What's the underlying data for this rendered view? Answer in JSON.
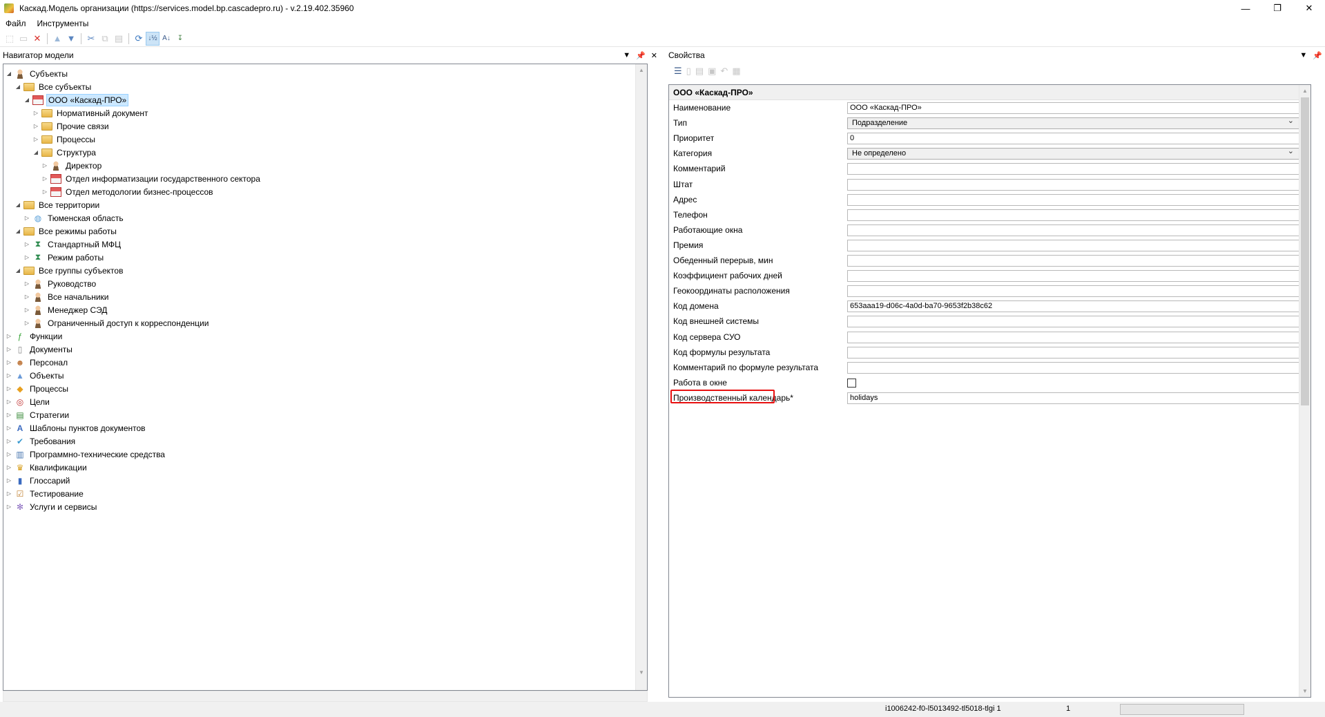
{
  "window": {
    "title": "Каскад.Модель организации (https://services.model.bp.cascadepro.ru) - v.2.19.402.35960",
    "minimize": "—",
    "restore": "❐",
    "close": "✕"
  },
  "menu": [
    "Файл",
    "Инструменты"
  ],
  "toolbar": {
    "icons": [
      "new-icon",
      "open-icon",
      "delete-icon",
      "move-up-icon",
      "move-down-icon",
      "cut-icon",
      "copy-icon",
      "paste-icon",
      "refresh-icon",
      "sort-asc-icon",
      "sort-desc-icon",
      "sort-icon"
    ]
  },
  "navigator": {
    "title": "Навигатор модели",
    "tree": [
      {
        "label": "Субъекты",
        "level": 0,
        "expanded": true,
        "icon": "subjects-icon"
      },
      {
        "label": "Все субъекты",
        "level": 1,
        "expanded": true,
        "icon": "folder-icon"
      },
      {
        "label": "ООО «Каскад-ПРО»",
        "level": 2,
        "expanded": true,
        "icon": "org-icon",
        "selected": true
      },
      {
        "label": "Нормативный документ",
        "level": 3,
        "expanded": false,
        "icon": "folder-icon"
      },
      {
        "label": "Прочие связи",
        "level": 3,
        "expanded": false,
        "icon": "folder-icon"
      },
      {
        "label": "Процессы",
        "level": 3,
        "expanded": false,
        "icon": "folder-icon"
      },
      {
        "label": "Структура",
        "level": 3,
        "expanded": true,
        "icon": "folder-icon"
      },
      {
        "label": "Директор",
        "level": 4,
        "expanded": false,
        "icon": "person-icon"
      },
      {
        "label": "Отдел информатизации государственного сектора",
        "level": 4,
        "expanded": false,
        "icon": "org-icon"
      },
      {
        "label": "Отдел методологии бизнес-процессов",
        "level": 4,
        "expanded": false,
        "icon": "org-icon"
      },
      {
        "label": "Все территории",
        "level": 1,
        "expanded": true,
        "icon": "folder-icon"
      },
      {
        "label": "Тюменская область",
        "level": 2,
        "expanded": false,
        "icon": "globe-icon"
      },
      {
        "label": "Все режимы работы",
        "level": 1,
        "expanded": true,
        "icon": "folder-icon"
      },
      {
        "label": "Стандартный МФЦ",
        "level": 2,
        "expanded": false,
        "icon": "schedule-icon"
      },
      {
        "label": "Режим работы",
        "level": 2,
        "expanded": false,
        "icon": "schedule-icon"
      },
      {
        "label": "Все группы субъектов",
        "level": 1,
        "expanded": true,
        "icon": "folder-icon"
      },
      {
        "label": "Руководство",
        "level": 2,
        "expanded": false,
        "icon": "group-icon"
      },
      {
        "label": "Все начальники",
        "level": 2,
        "expanded": false,
        "icon": "group-icon"
      },
      {
        "label": "Менеджер СЭД",
        "level": 2,
        "expanded": false,
        "icon": "group-icon"
      },
      {
        "label": "Ограниченный доступ к корреспонденции",
        "level": 2,
        "expanded": false,
        "icon": "group-icon"
      },
      {
        "label": "Функции",
        "level": 0,
        "expanded": false,
        "icon": "function-icon"
      },
      {
        "label": "Документы",
        "level": 0,
        "expanded": false,
        "icon": "document-icon"
      },
      {
        "label": "Персонал",
        "level": 0,
        "expanded": false,
        "icon": "personnel-icon"
      },
      {
        "label": "Объекты",
        "level": 0,
        "expanded": false,
        "icon": "objects-icon"
      },
      {
        "label": "Процессы",
        "level": 0,
        "expanded": false,
        "icon": "process-icon"
      },
      {
        "label": "Цели",
        "level": 0,
        "expanded": false,
        "icon": "goals-icon"
      },
      {
        "label": "Стратегии",
        "level": 0,
        "expanded": false,
        "icon": "strategy-icon"
      },
      {
        "label": "Шаблоны пунктов документов",
        "level": 0,
        "expanded": false,
        "icon": "template-icon"
      },
      {
        "label": "Требования",
        "level": 0,
        "expanded": false,
        "icon": "requirements-icon"
      },
      {
        "label": "Программно-технические средства",
        "level": 0,
        "expanded": false,
        "icon": "software-icon"
      },
      {
        "label": "Квалификации",
        "level": 0,
        "expanded": false,
        "icon": "qualification-icon"
      },
      {
        "label": "Глоссарий",
        "level": 0,
        "expanded": false,
        "icon": "glossary-icon"
      },
      {
        "label": "Тестирование",
        "level": 0,
        "expanded": false,
        "icon": "testing-icon"
      },
      {
        "label": "Услуги и сервисы",
        "level": 0,
        "expanded": false,
        "icon": "services-icon"
      }
    ]
  },
  "properties": {
    "title": "Свойства",
    "group": "ООО «Каскад-ПРО»",
    "rows": [
      {
        "name": "Наименование",
        "value": "ООО «Каскад-ПРО»",
        "type": "text"
      },
      {
        "name": "Тип",
        "value": "Подразделение",
        "type": "combo"
      },
      {
        "name": "Приоритет",
        "value": "0",
        "type": "text"
      },
      {
        "name": "Категория",
        "value": "Не определено",
        "type": "combo"
      },
      {
        "name": "Комментарий",
        "value": "",
        "type": "text"
      },
      {
        "name": "Штат",
        "value": "",
        "type": "text"
      },
      {
        "name": "Адрес",
        "value": "",
        "type": "text"
      },
      {
        "name": "Телефон",
        "value": "",
        "type": "text"
      },
      {
        "name": "Работающие окна",
        "value": "",
        "type": "text"
      },
      {
        "name": "Премия",
        "value": "",
        "type": "text"
      },
      {
        "name": "Обеденный перерыв, мин",
        "value": "",
        "type": "text"
      },
      {
        "name": "Коэффициент рабочих дней",
        "value": "",
        "type": "text"
      },
      {
        "name": "Геокоординаты расположения",
        "value": "",
        "type": "text"
      },
      {
        "name": "Код домена",
        "value": "653aaa19-d06c-4a0d-ba70-9653f2b38c62",
        "type": "text"
      },
      {
        "name": "Код внешней системы",
        "value": "",
        "type": "text"
      },
      {
        "name": "Код сервера СУО",
        "value": "",
        "type": "text"
      },
      {
        "name": "Код формулы результата",
        "value": "",
        "type": "text"
      },
      {
        "name": "Комментарий по формуле результата",
        "value": "",
        "type": "text"
      },
      {
        "name": "Работа в окне",
        "value": "",
        "type": "checkbox"
      },
      {
        "name": "Производственный календарь*",
        "value": "holidays",
        "type": "text",
        "highlighted": true
      }
    ]
  },
  "status": {
    "text": "i1006242-f0-l5013492-tl5018-tlgi  1",
    "count": "1"
  },
  "colors": {
    "selection": "#cce8ff",
    "highlight": "#e81010"
  }
}
